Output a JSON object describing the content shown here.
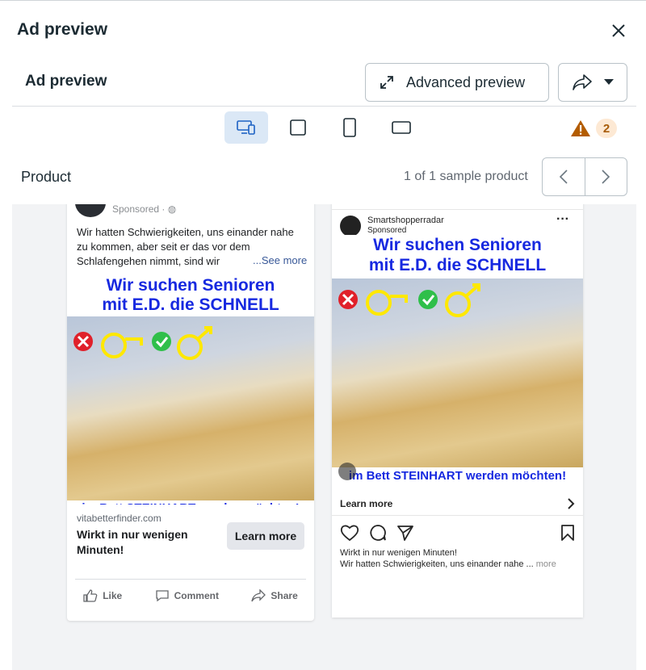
{
  "dialog": {
    "title": "Ad preview",
    "subtitle": "Ad preview",
    "advanced_preview_label": "Advanced preview",
    "warning_count": "2"
  },
  "product": {
    "label": "Product",
    "sample_count": "1 of 1 sample product"
  },
  "creative": {
    "headline_line1": "Wir suchen Senioren",
    "headline_line2": "mit E.D. die SCHNELL",
    "footer_line": "im Bett STEINHART werden möchten!"
  },
  "facebook": {
    "sponsored": "Sponsored · ",
    "body_text": "Wir hatten Schwierigkeiten, uns einander nahe zu kommen, aber seit er das vor dem Schlafengehen nimmt, sind wir",
    "see_more": "...See more",
    "domain": "vitabetterfinder.com",
    "cta_headline": "Wirkt in nur wenigen Minuten!",
    "learn_more": "Learn more",
    "like": "Like",
    "comment": "Comment",
    "share": "Share"
  },
  "instagram": {
    "account": "Smartshopperradar",
    "sponsored": "Sponsored",
    "learn_more": "Learn more",
    "caption_line1": "Wirkt in nur wenigen Minuten!",
    "caption_line2": "Wir hatten Schwierigkeiten, uns einander nahe ... ",
    "more": "more"
  },
  "colors": {
    "headline_blue": "#1729e0",
    "active_device_bg": "#dbe8f6",
    "warning_orange": "#b35c00"
  },
  "icons": [
    "close-icon",
    "expand-icon",
    "share-arrow-icon",
    "caret-down-icon",
    "desktop-mobile-icon",
    "square-icon",
    "phone-icon",
    "landscape-icon",
    "warning-icon",
    "chevron-left-icon",
    "chevron-right-icon",
    "like-icon",
    "comment-icon",
    "share-icon",
    "heart-icon",
    "comment-bubble-icon",
    "send-icon",
    "bookmark-icon"
  ]
}
